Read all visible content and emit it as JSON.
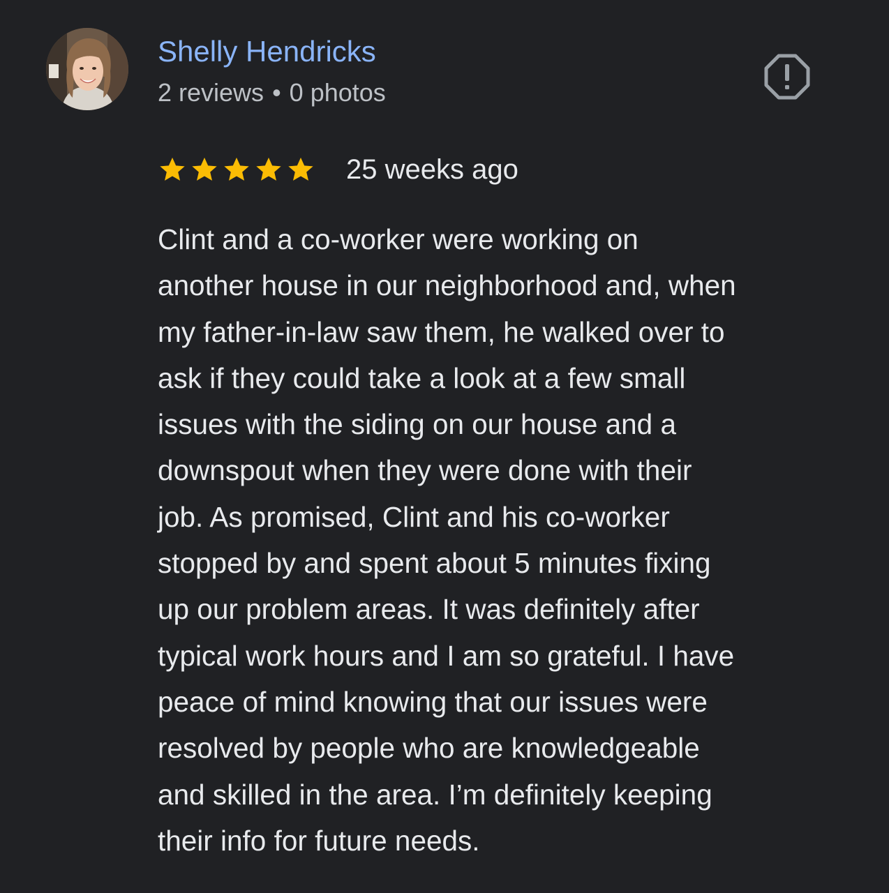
{
  "review": {
    "reviewer": {
      "name": "Shelly Hendricks",
      "reviews_count": "2 reviews",
      "separator": "•",
      "photos_count": "0 photos"
    },
    "rating": {
      "stars": 5,
      "max_stars": 5,
      "star_color": "#fbbc04"
    },
    "time_ago": "25 weeks ago",
    "text_lines": [
      "Clint and a co-worker were working on",
      "another house in our neighborhood and, when",
      "my father-in-law saw them, he walked over to",
      "ask if they could take a look at a few small",
      "issues with the siding on our house and a",
      "downspout when they were done with their",
      "job. As promised, Clint and his co-worker",
      "stopped by and spent about 5 minutes fixing",
      "up our problem areas. It was definitely after",
      "typical work hours and I am so grateful. I have",
      "peace of mind knowing that our issues were",
      "resolved by people who are knowledgeable",
      "and skilled in the area. I’m definitely keeping",
      "their info for future needs."
    ]
  },
  "icons": {
    "report": "report-octagon-exclamation-icon",
    "star": "star-icon",
    "avatar": "profile-photo"
  },
  "colors": {
    "background": "#202124",
    "name_link": "#8ab4f8",
    "meta_text": "#bdc1c6",
    "body_text": "#e8eaed",
    "report_icon": "#9aa0a6"
  }
}
